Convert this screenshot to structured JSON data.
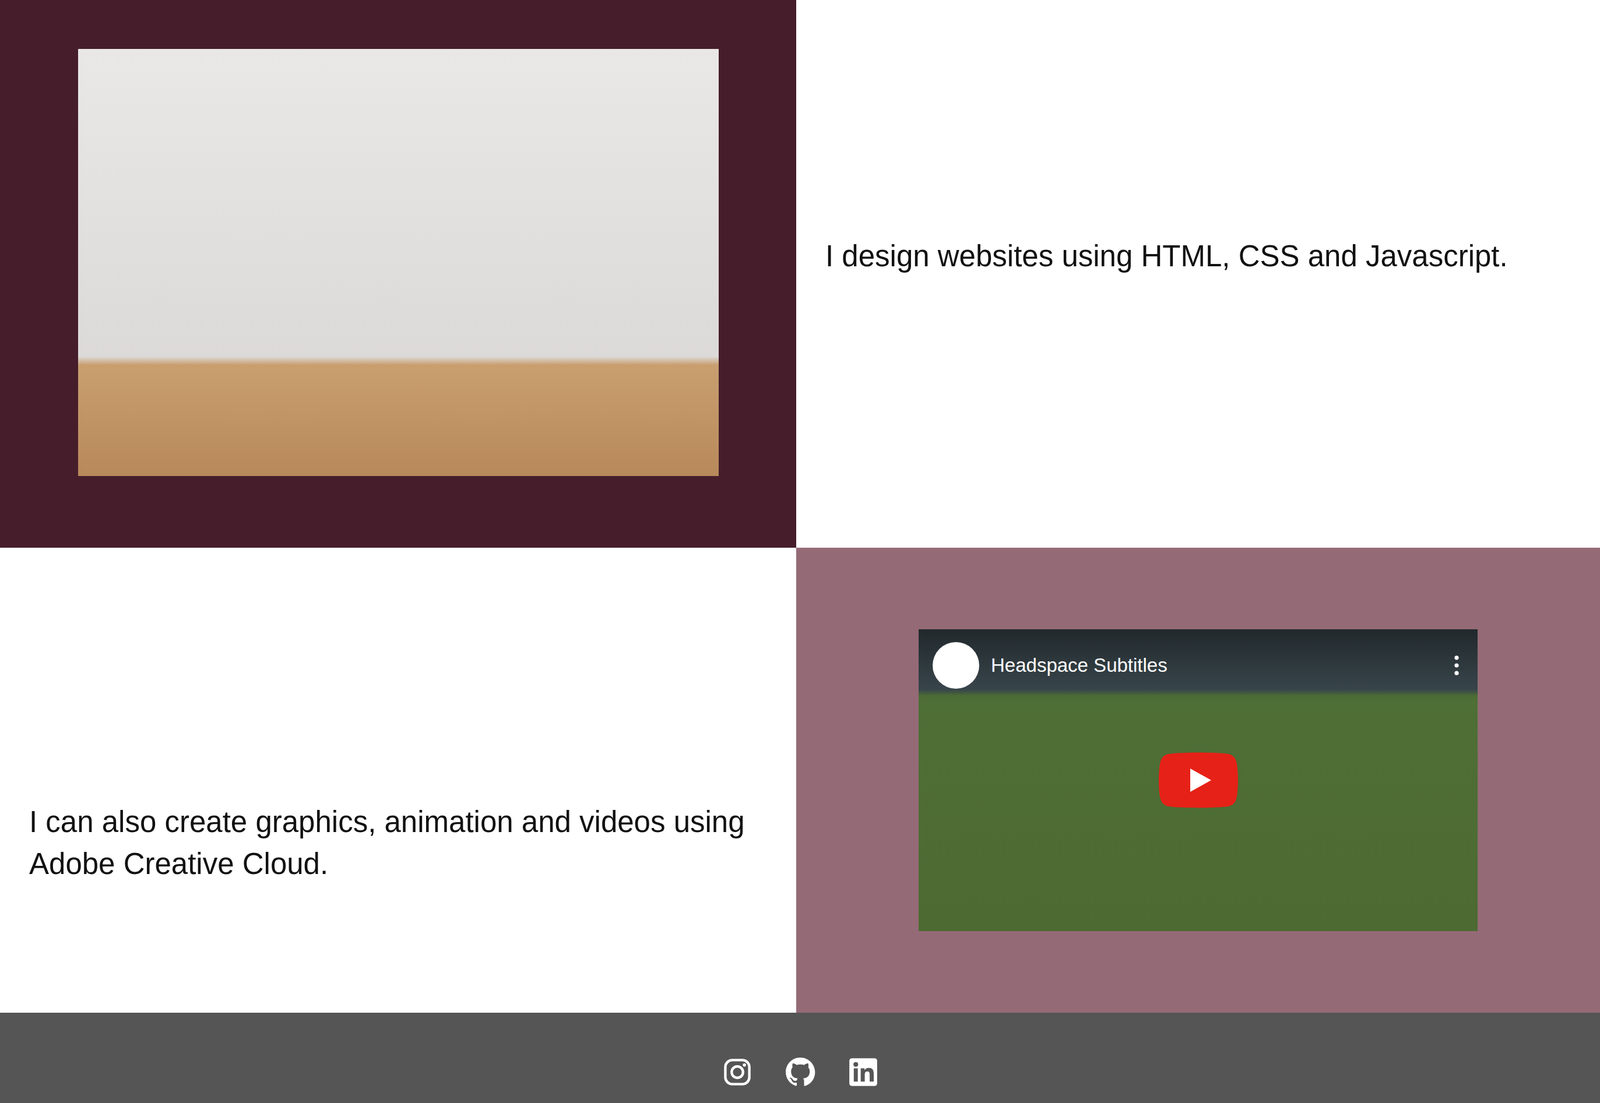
{
  "sections": [
    {
      "text": "I design websites using HTML, CSS and Javascript."
    },
    {
      "text": "I can also create graphics, animation and videos using Adobe Creative Cloud."
    }
  ],
  "video": {
    "title": "Headspace Subtitles"
  }
}
